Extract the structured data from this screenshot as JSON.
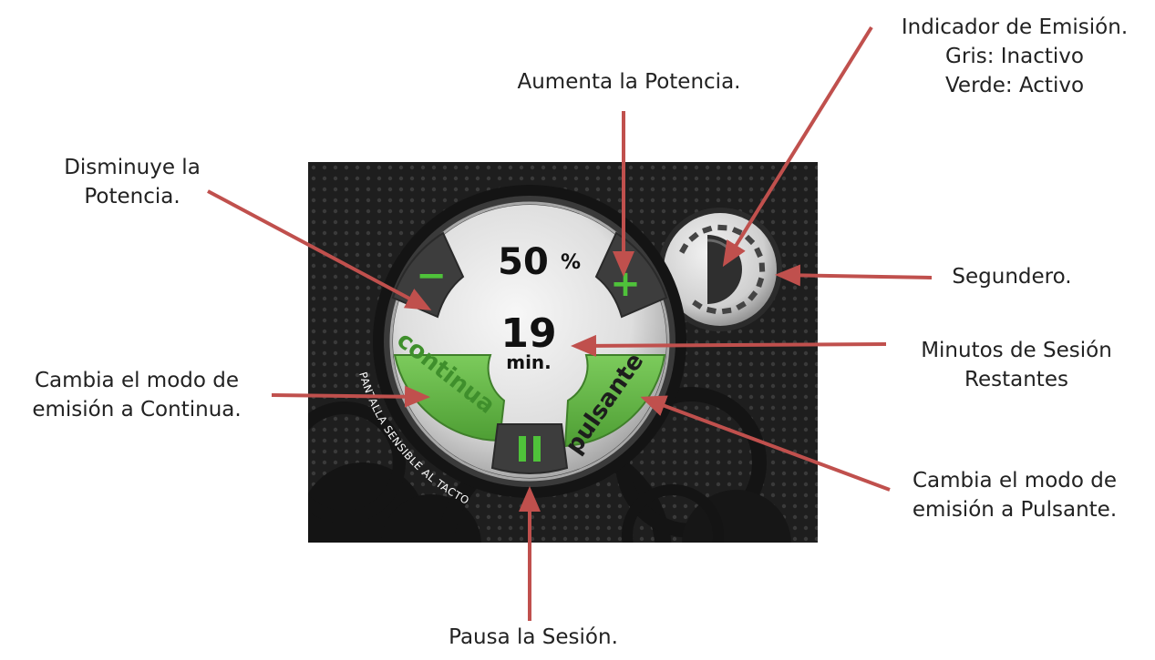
{
  "annotations": {
    "indicator": [
      "Indicador de Emisión.",
      "Gris: Inactivo",
      "Verde: Activo"
    ],
    "increase": "Aumenta la Potencia.",
    "decrease": [
      "Disminuye la",
      "Potencia."
    ],
    "second_hand": "Segundero.",
    "minutes": [
      "Minutos de Sesión",
      "Restantes"
    ],
    "mode_continuous": [
      "Cambia el modo de",
      "emisión a Continua."
    ],
    "mode_pulsed": [
      "Cambia el modo de",
      "emisión a Pulsante."
    ],
    "pause": "Pausa la Sesión."
  },
  "device": {
    "power_value": "50",
    "power_unit": "%",
    "minutes_value": "19",
    "minutes_unit": "min.",
    "minus_symbol": "−",
    "plus_symbol": "+",
    "mode_continuous_label": "continua",
    "mode_pulsed_label": "pulsante",
    "touch_text": "PANTALLA SENSIBLE AL TACTO",
    "icons": {
      "pause": "pause-icon",
      "minus": "minus-icon",
      "plus": "plus-icon",
      "indicator": "emission-indicator-icon"
    }
  },
  "colors": {
    "arrow": "#c0504d",
    "green": "#5cb040",
    "green_bright": "#4fc23a",
    "panel_bg": "#1e1e1e",
    "button_dark": "#3d3d3d"
  }
}
